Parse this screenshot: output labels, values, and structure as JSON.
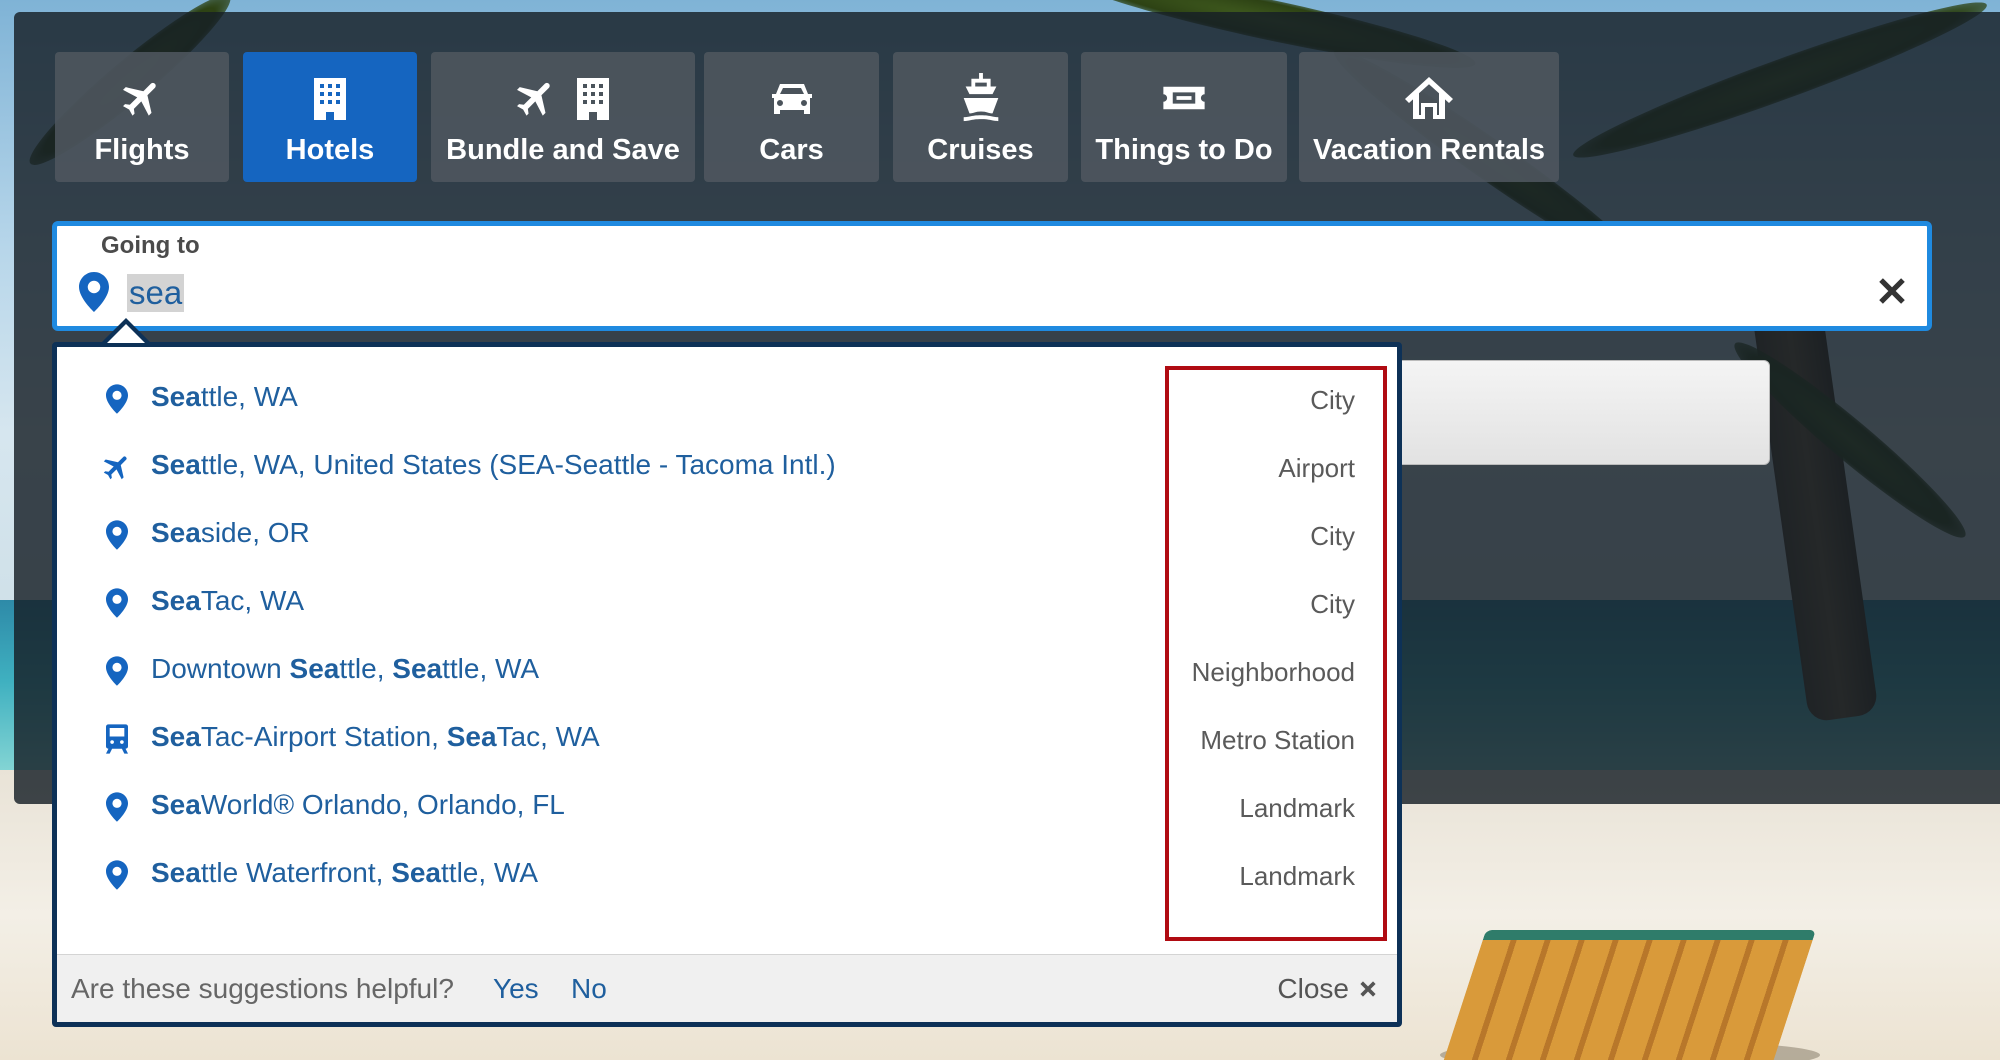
{
  "tabs": [
    {
      "id": "flights",
      "label": "Flights",
      "icons": [
        "airplane-icon"
      ],
      "active": false
    },
    {
      "id": "hotels",
      "label": "Hotels",
      "icons": [
        "hotel-building-icon"
      ],
      "active": true
    },
    {
      "id": "bundle",
      "label": "Bundle and Save",
      "icons": [
        "airplane-icon",
        "hotel-building-icon"
      ],
      "active": false
    },
    {
      "id": "cars",
      "label": "Cars",
      "icons": [
        "car-icon"
      ],
      "active": false
    },
    {
      "id": "cruises",
      "label": "Cruises",
      "icons": [
        "ship-icon"
      ],
      "active": false
    },
    {
      "id": "things",
      "label": "Things to Do",
      "icons": [
        "ticket-icon"
      ],
      "active": false
    },
    {
      "id": "rentals",
      "label": "Vacation Rentals",
      "icons": [
        "house-icon"
      ],
      "active": false
    }
  ],
  "search": {
    "label": "Going to",
    "value": "sea",
    "clear_icon": "close-icon"
  },
  "suggestions": [
    {
      "parts": [
        [
          "Sea",
          true
        ],
        [
          "ttle, WA",
          false
        ]
      ],
      "type": "City",
      "icon": "map-pin-icon"
    },
    {
      "parts": [
        [
          "Sea",
          true
        ],
        [
          "ttle, WA, United States (SEA-Seattle - Tacoma Intl.)",
          false
        ]
      ],
      "type": "Airport",
      "icon": "airplane-icon"
    },
    {
      "parts": [
        [
          "Sea",
          true
        ],
        [
          "side, OR",
          false
        ]
      ],
      "type": "City",
      "icon": "map-pin-icon"
    },
    {
      "parts": [
        [
          "Sea",
          true
        ],
        [
          "Tac, WA",
          false
        ]
      ],
      "type": "City",
      "icon": "map-pin-icon"
    },
    {
      "parts": [
        [
          "Downtown ",
          false
        ],
        [
          "Sea",
          true
        ],
        [
          "ttle, ",
          false
        ],
        [
          "Sea",
          true
        ],
        [
          "ttle, WA",
          false
        ]
      ],
      "type": "Neighborhood",
      "icon": "map-pin-icon"
    },
    {
      "parts": [
        [
          "Sea",
          true
        ],
        [
          "Tac-Airport Station, ",
          false
        ],
        [
          "Sea",
          true
        ],
        [
          "Tac, WA",
          false
        ]
      ],
      "type": "Metro Station",
      "icon": "train-icon"
    },
    {
      "parts": [
        [
          "Sea",
          true
        ],
        [
          "World® Orlando, Orlando, FL",
          false
        ]
      ],
      "type": "Landmark",
      "icon": "map-pin-icon"
    },
    {
      "parts": [
        [
          "Sea",
          true
        ],
        [
          "ttle Waterfront, ",
          false
        ],
        [
          "Sea",
          true
        ],
        [
          "ttle, WA",
          false
        ]
      ],
      "type": "Landmark",
      "icon": "map-pin-icon"
    }
  ],
  "footer": {
    "question": "Are these suggestions helpful?",
    "yes": "Yes",
    "no": "No",
    "close": "Close"
  },
  "colors": {
    "active_tab": "#1565c0",
    "link_blue": "#1f5f9e",
    "field_border": "#1f8ae0",
    "highlight_box": "#b00b12"
  }
}
